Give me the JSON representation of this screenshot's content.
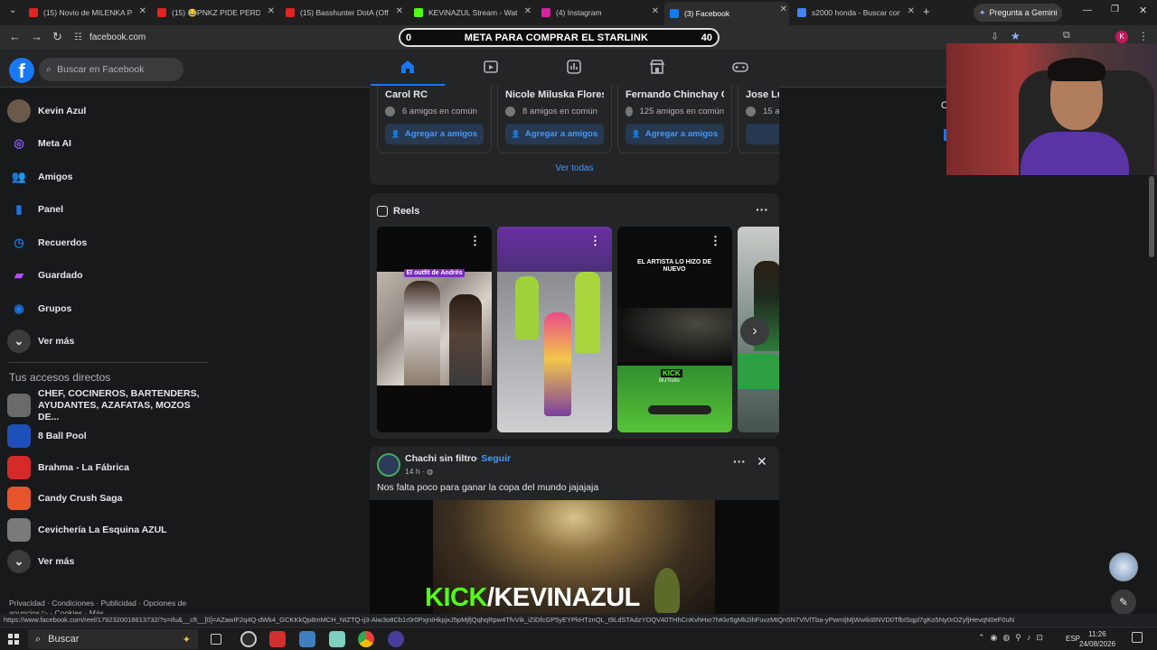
{
  "browser": {
    "tabs": [
      {
        "title": "(15) Novio de MILENKA PA",
        "fav_color": "#e02424"
      },
      {
        "title": "(15) 😂PNKZ PIDE PERDON",
        "fav_color": "#e02424"
      },
      {
        "title": "(15) Basshunter DotA (Offi",
        "fav_color": "#e02424"
      },
      {
        "title": "KEViNAZUL Stream - Watc",
        "fav_color": "#53fc18"
      },
      {
        "title": "(4) Instagram",
        "fav_color": "#d6249f"
      },
      {
        "title": "(3) Facebook",
        "fav_color": "#1877f2"
      },
      {
        "title": "s2000 honda - Buscar con",
        "fav_color": "#4285f4"
      }
    ],
    "gemini_button": "Pregunta a Gemini",
    "url": "facebook.com",
    "status_url": "https://www.facebook.com/reel/1792320018613732/?s=ifu&__cft__[0]=AZawIF2q4Q-dWk4_GCKKkQp8mMCH_NIZTQ-ij3-Aiw3o8Cb1r0r0PxjnIHkpjxJ5pMjfjQqhqRpw4TfvVik_iZiDfcGP5yEYPkHTznQL_t9LdSTAdzYOQV40THhCnKvhHxr7hKkr5gMk2ihFuvzMtQn5N7VlVlTba-yPwmljMjWwIkI8NVD0TfbISqpl7gKo5Ny0rOZyfjHevqN0eF0uN"
  },
  "overlay": {
    "left_value": "0",
    "title": "META PARA COMPRAR EL STARLINK",
    "right_value": "40"
  },
  "facebook": {
    "search_placeholder": "Buscar en Facebook",
    "sidebar": [
      {
        "label": "Kevin Azul",
        "icon": "avatar",
        "color": "#6b5a4a"
      },
      {
        "label": "Meta AI",
        "icon": "meta-ai-icon",
        "color": "#8b5cf6"
      },
      {
        "label": "Amigos",
        "icon": "friends-icon",
        "color": "#1b74e4"
      },
      {
        "label": "Panel",
        "icon": "panel-icon",
        "color": "#1b74e4"
      },
      {
        "label": "Recuerdos",
        "icon": "memories-icon",
        "color": "#1b74e4"
      },
      {
        "label": "Guardado",
        "icon": "saved-icon",
        "color": "#b64cff"
      },
      {
        "label": "Grupos",
        "icon": "groups-icon",
        "color": "#1b74e4"
      },
      {
        "label": "Ver más",
        "icon": "chevron-down-icon",
        "color": "#3a3b3c"
      }
    ],
    "shortcuts_title": "Tus accesos directos",
    "shortcuts": [
      {
        "label": "CHEF, COCINEROS, BARTENDERS, AYUDANTES, AZAFATAS, MOZOS DE...",
        "color": "#6a6a6a"
      },
      {
        "label": "8 Ball Pool",
        "color": "#1e4fb8"
      },
      {
        "label": "Brahma - La Fábrica",
        "color": "#d62a2a"
      },
      {
        "label": "Candy Crush Saga",
        "color": "#e5542b"
      },
      {
        "label": "Cevichería La Esquina AZUL",
        "color": "#7a7a7a"
      },
      {
        "label": "Ver más",
        "color": "#3a3b3c"
      }
    ],
    "footer": "Privacidad · Condiciones · Publicidad · Opciones de anuncios ▷ · Cookies · Más",
    "friends": [
      {
        "name": "Carol RC",
        "mutual": "6 amigos en común",
        "button": "Agregar a amigos"
      },
      {
        "name": "Nicole Miluska Flores",
        "mutual": "8 amigos en común",
        "button": "Agregar a amigos"
      },
      {
        "name": "Fernando Chinchay Castillo",
        "mutual": "125 amigos en común",
        "button": "Agregar a amigos"
      },
      {
        "name": "Jose Lu",
        "mutual": "15 am",
        "button": "Agr"
      }
    ],
    "see_all": "Ver todas",
    "reels_title": "Reels",
    "reels": [
      {
        "caption": "El outfit de Andrés"
      },
      {
        "caption": ""
      },
      {
        "caption": "EL ARTISTA LO HIZO DE NUEVO",
        "kick": "KICK",
        "kick_sub": "BUTlsito"
      },
      {
        "caption": ""
      }
    ],
    "post": {
      "author": "Chachi sin filtro",
      "follow": "· Seguir",
      "time": "14 h ·",
      "text": "Nos falta poco para ganar la copa del mundo jajajaja",
      "overlay_kick": "KICK",
      "overlay_handle": "/KEVINAZUL"
    }
  },
  "taskbar": {
    "search": "Buscar",
    "time": "11:26",
    "date": "24/08/2026",
    "lang": "ESP"
  }
}
